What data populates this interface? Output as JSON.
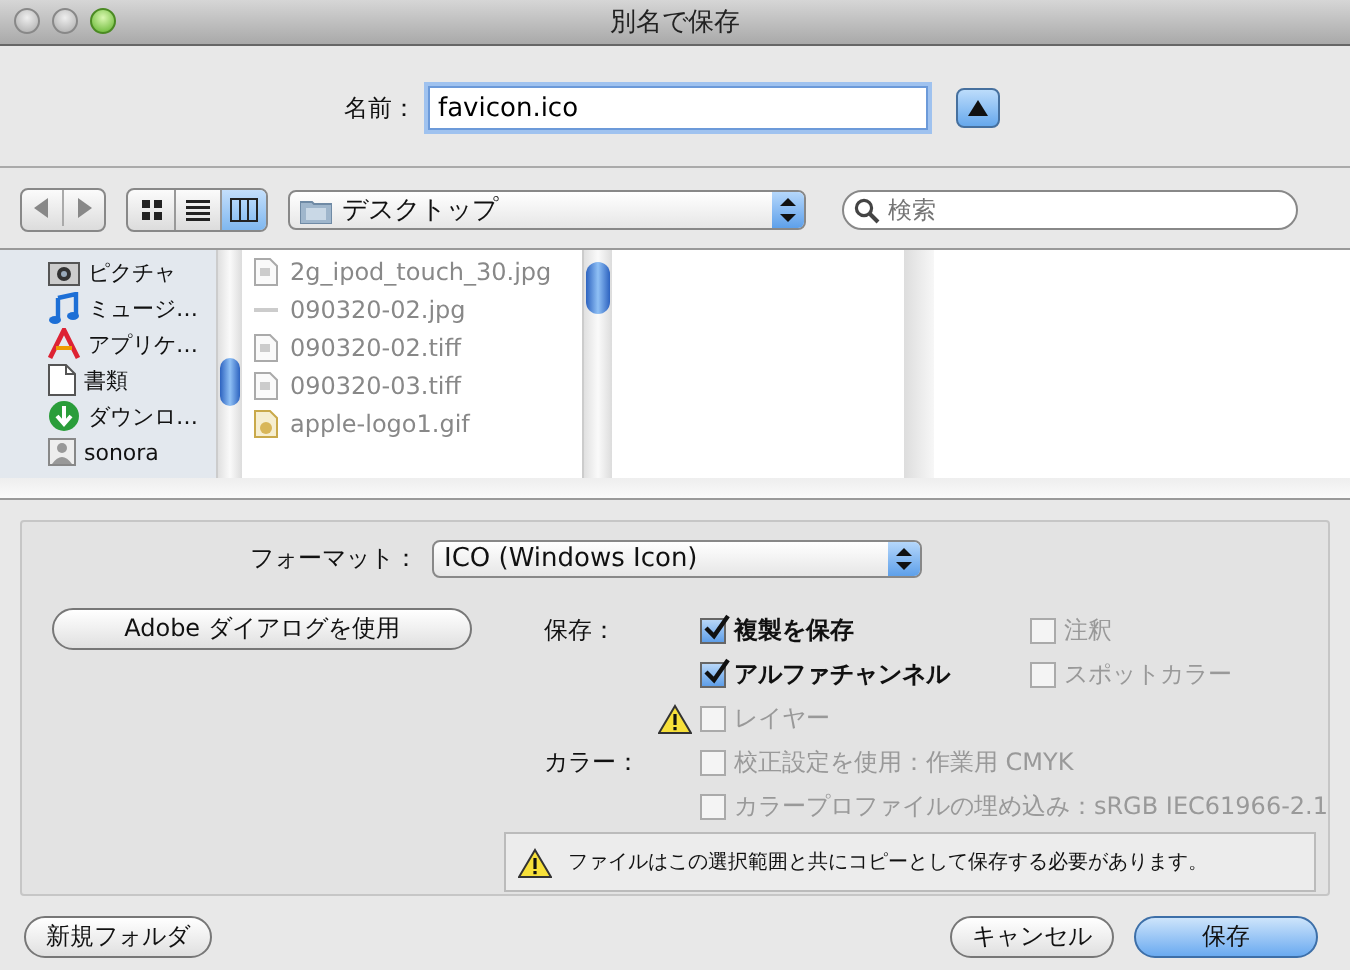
{
  "window": {
    "title": "別名で保存"
  },
  "name_field": {
    "label": "名前：",
    "value": "favicon.ico"
  },
  "toolbar": {
    "location": "デスクトップ",
    "search": {
      "placeholder": "検索"
    },
    "view_modes": [
      {
        "kind": "icons",
        "selected": false
      },
      {
        "kind": "list",
        "selected": false
      },
      {
        "kind": "columns",
        "selected": true
      }
    ]
  },
  "sidebar": {
    "items": [
      {
        "label": "ピクチャ",
        "kind": "pictures"
      },
      {
        "label": "ミュージ…",
        "kind": "music"
      },
      {
        "label": "アプリケ…",
        "kind": "apps"
      },
      {
        "label": "書類",
        "kind": "documents"
      },
      {
        "label": "ダウンロ…",
        "kind": "downloads"
      },
      {
        "label": "sonora",
        "kind": "home"
      }
    ]
  },
  "files": [
    {
      "name": "2g_ipod_touch_30.jpg",
      "kind": "image",
      "disabled": true
    },
    {
      "name": "090320-02.jpg",
      "kind": "blank",
      "disabled": true
    },
    {
      "name": "090320-02.tiff",
      "kind": "image",
      "disabled": true
    },
    {
      "name": "090320-03.tiff",
      "kind": "image",
      "disabled": true
    },
    {
      "name": "apple-logo1.gif",
      "kind": "gif",
      "disabled": true
    }
  ],
  "format": {
    "label": "フォーマット：",
    "value": "ICO (Windows Icon)"
  },
  "adobe_button": "Adobe ダイアログを使用",
  "save_options": {
    "label": "保存：",
    "rows": [
      {
        "items": [
          {
            "label": "複製を保存",
            "checked": true,
            "disabled": false,
            "warning": false
          },
          {
            "label": "注釈",
            "checked": false,
            "disabled": true,
            "warning": false
          }
        ]
      },
      {
        "items": [
          {
            "label": "アルファチャンネル",
            "checked": true,
            "disabled": false,
            "warning": false
          },
          {
            "label": "スポットカラー",
            "checked": false,
            "disabled": true,
            "warning": false
          }
        ]
      },
      {
        "items": [
          {
            "label": "レイヤー",
            "checked": false,
            "disabled": true,
            "warning": true
          }
        ]
      }
    ]
  },
  "color_options": {
    "label": "カラー：",
    "items": [
      {
        "label": "校正設定を使用：作業用 CMYK",
        "checked": false,
        "disabled": true
      },
      {
        "label": "カラープロファイルの埋め込み：sRGB IEC61966-2.1",
        "checked": false,
        "disabled": true
      }
    ]
  },
  "notice": "ファイルはこの選択範囲と共にコピーとして保存する必要があります。",
  "buttons": [
    {
      "label": "新規フォルダ",
      "default": false
    },
    {
      "label": "キャンセル",
      "default": false
    },
    {
      "label": "保存",
      "default": true
    }
  ]
}
